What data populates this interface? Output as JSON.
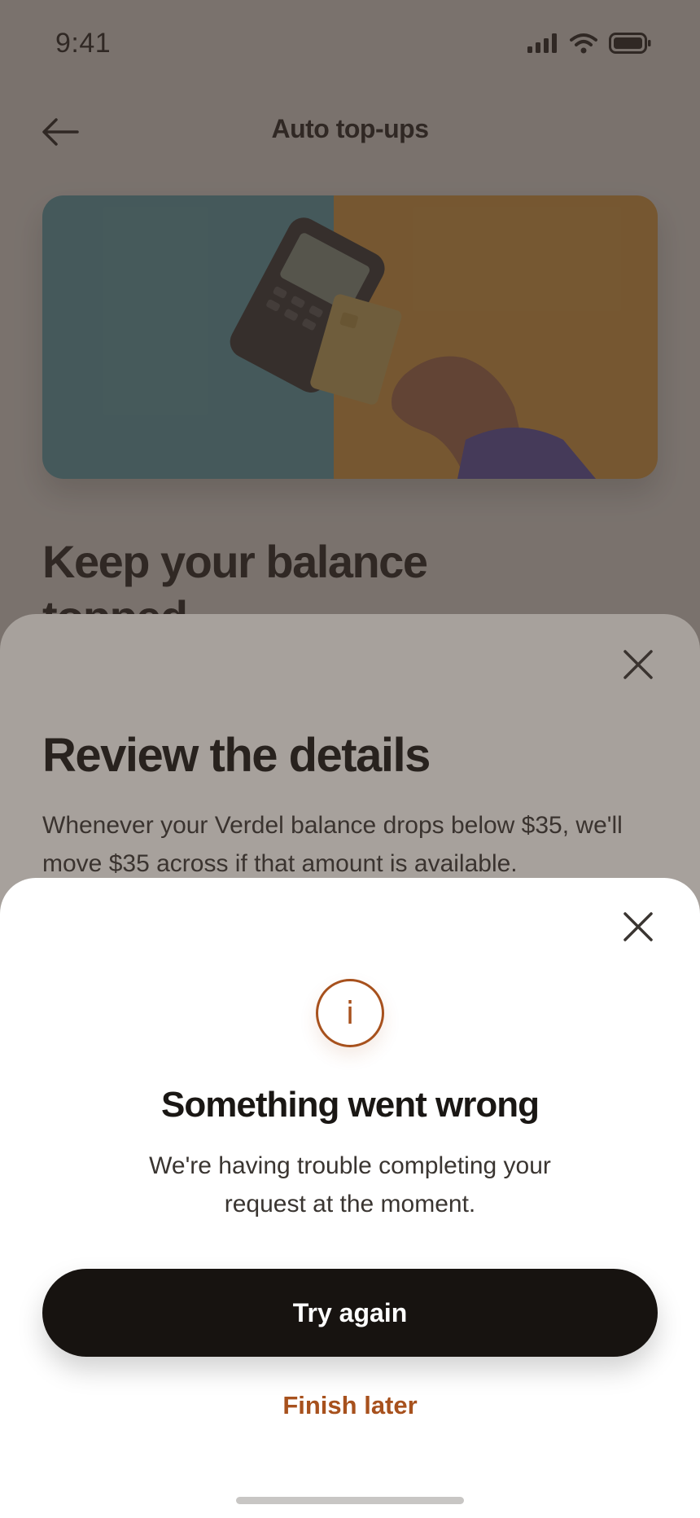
{
  "status_bar": {
    "time": "9:41",
    "icons": [
      "signal-icon",
      "wifi-icon",
      "battery-icon"
    ]
  },
  "header": {
    "title": "Auto top-ups",
    "back_icon": "arrow-left-icon"
  },
  "hero": {
    "image": "card-terminal-payment-photo"
  },
  "page": {
    "heading": "Keep your balance topped"
  },
  "review_sheet": {
    "title": "Review the details",
    "body": "Whenever your Verdel balance drops below $35, we'll move $35 across if that amount is available.",
    "close_icon": "close-icon"
  },
  "error_sheet": {
    "icon": "info-icon",
    "icon_glyph": "i",
    "title": "Something went wrong",
    "message": "We're having trouble completing your request at the moment.",
    "primary_label": "Try again",
    "secondary_label": "Finish later",
    "close_icon": "close-icon"
  },
  "colors": {
    "accent": "#a7511d",
    "primary_button": "#171310",
    "background": "#f4f1ec"
  }
}
